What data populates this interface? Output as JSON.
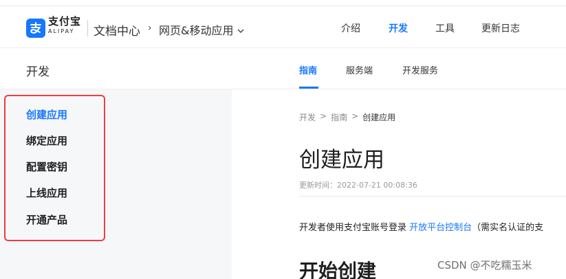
{
  "header": {
    "logo_cn": "支付宝",
    "logo_en": "ALIPAY",
    "doc_center": "文档中心",
    "product_select": "网页&移动应用",
    "nav": [
      {
        "label": "介绍",
        "active": false
      },
      {
        "label": "开发",
        "active": true
      },
      {
        "label": "工具",
        "active": false
      },
      {
        "label": "更新日志",
        "active": false
      }
    ]
  },
  "subheader": {
    "section_title": "开发",
    "tabs": [
      {
        "label": "指南",
        "active": true
      },
      {
        "label": "服务端",
        "active": false
      },
      {
        "label": "开发服务",
        "active": false
      }
    ]
  },
  "sidebar": {
    "items": [
      {
        "label": "创建应用",
        "active": true
      },
      {
        "label": "绑定应用",
        "active": false
      },
      {
        "label": "配置密钥",
        "active": false
      },
      {
        "label": "上线应用",
        "active": false
      },
      {
        "label": "开通产品",
        "active": false
      }
    ]
  },
  "content": {
    "breadcrumb": [
      "开发",
      "指南",
      "创建应用"
    ],
    "breadcrumb_separator": ">",
    "title": "创建应用",
    "updated": "更新时间：2022-07-21 00:08:36",
    "para_prefix": "开发者使用支付宝账号登录 ",
    "para_link": "开放平台控制台",
    "para_suffix": "（需实名认证的支",
    "section_heading": "开始创建"
  },
  "watermark": "CSDN @不吃糯玉米",
  "colors": {
    "accent": "#1677ff",
    "highlight_border": "#ec3e3e",
    "sidebar_bg": "#f6f7f9"
  }
}
